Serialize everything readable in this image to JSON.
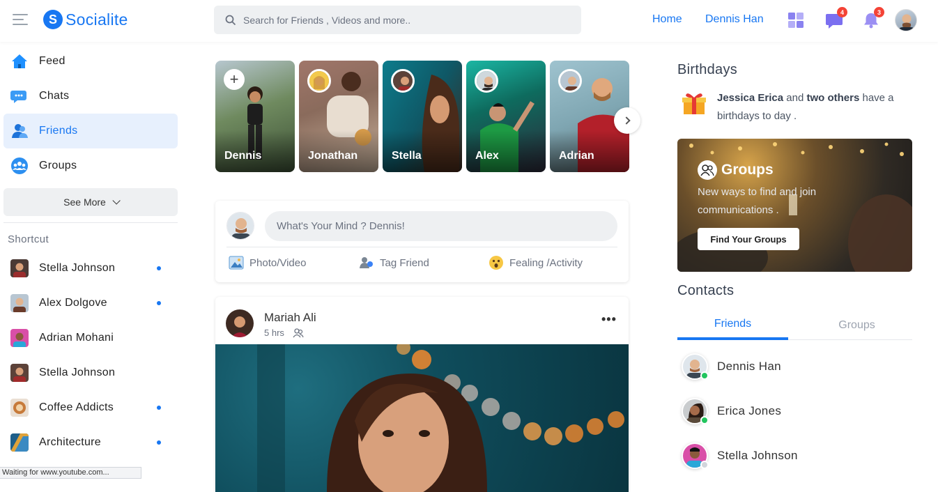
{
  "app": {
    "name": "Socialite",
    "logo_letter": "S",
    "accent": "#1877f2"
  },
  "header": {
    "search_placeholder": "Search for Friends , Videos and more..",
    "links": [
      "Home",
      "Dennis Han"
    ],
    "messages_badge": "4",
    "notifications_badge": "3"
  },
  "sidebar": {
    "items": [
      {
        "label": "Feed",
        "icon": "home-icon"
      },
      {
        "label": "Chats",
        "icon": "chat-icon"
      },
      {
        "label": "Friends",
        "icon": "friends-icon",
        "active": true
      },
      {
        "label": "Groups",
        "icon": "groups-icon"
      }
    ],
    "see_more": "See More",
    "shortcut_title": "Shortcut",
    "shortcuts": [
      {
        "label": "Stella Johnson",
        "unread": true
      },
      {
        "label": "Alex Dolgove",
        "unread": true
      },
      {
        "label": "Adrian Mohani",
        "unread": false
      },
      {
        "label": "Stella Johnson",
        "unread": false
      },
      {
        "label": "Coffee Addicts",
        "unread": true
      },
      {
        "label": "Architecture",
        "unread": true
      }
    ]
  },
  "status_bar": "Waiting for www.youtube.com...",
  "stories": [
    "Dennis",
    "Jonathan",
    "Stella",
    "Alex",
    "Adrian"
  ],
  "composer": {
    "placeholder": "What's Your Mind ? Dennis!",
    "actions": [
      "Photo/Video",
      "Tag Friend",
      "Fealing /Activity"
    ]
  },
  "post": {
    "author": "Mariah Ali",
    "time": "5 hrs",
    "more": "•••"
  },
  "birthdays": {
    "title": "Birthdays",
    "name": "Jessica Erica",
    "connector": "and",
    "others": "two others",
    "suffix": "have a birthdays to day ."
  },
  "groups_card": {
    "title": "Groups",
    "description": "New ways to find and join communications .",
    "button": "Find Your Groups"
  },
  "contacts": {
    "title": "Contacts",
    "tabs": [
      "Friends",
      "Groups"
    ],
    "list": [
      {
        "name": "Dennis Han",
        "online": true
      },
      {
        "name": "Erica Jones",
        "online": true
      },
      {
        "name": "Stella Johnson",
        "online": false
      }
    ]
  }
}
